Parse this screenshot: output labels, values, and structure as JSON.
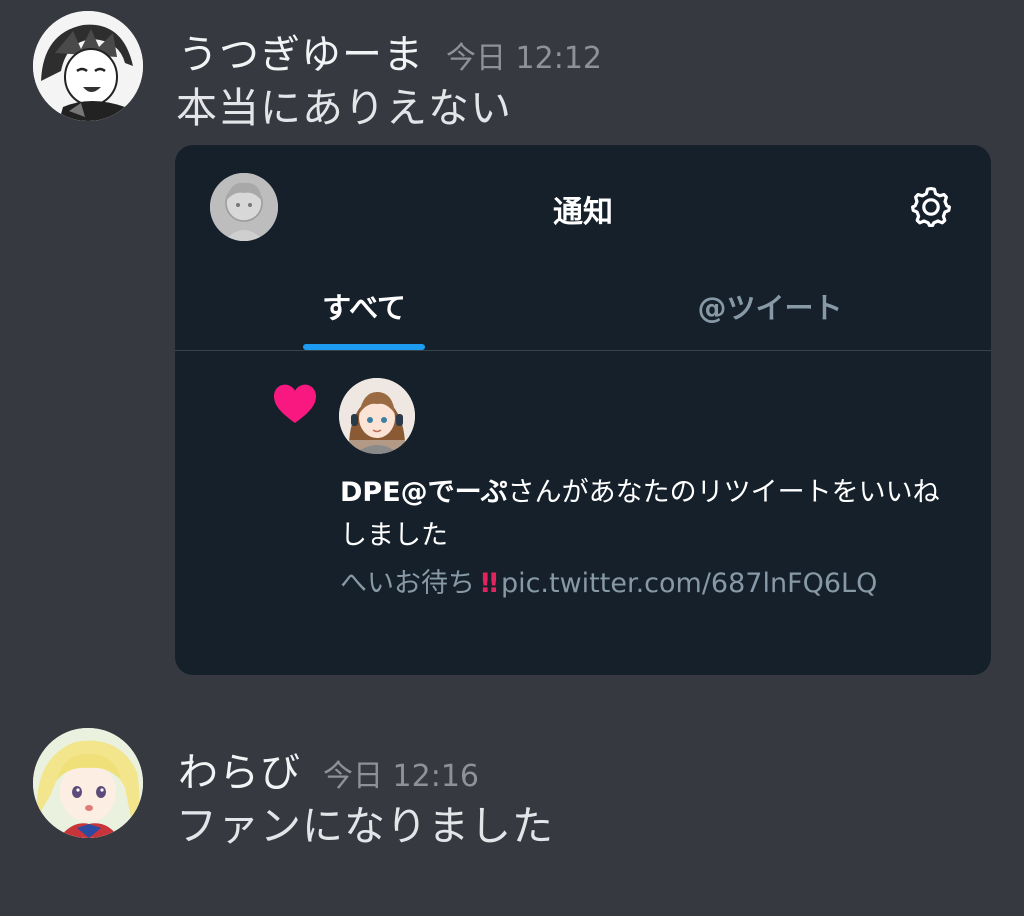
{
  "messages": [
    {
      "username": "うつぎゆーま",
      "timestamp": "今日 12:12",
      "content": "本当にありえない"
    },
    {
      "username": "わらび",
      "timestamp": "今日 12:16",
      "content": "ファンになりました"
    }
  ],
  "embed": {
    "title": "通知",
    "tabs": [
      {
        "label": "すべて",
        "active": true
      },
      {
        "label": "@ツイート",
        "active": false
      }
    ],
    "notification": {
      "user": "DPE@でーぷ",
      "action": "さんがあなたのリツイートをいいねしました",
      "tweet_text": "へいお待ち",
      "tweet_emoji": "‼",
      "tweet_link": "pic.twitter.com/687lnFQ6LQ"
    },
    "colors": {
      "background": "#15202b",
      "accent": "#1d9bf0",
      "like": "#f91880",
      "muted": "#8899a6"
    },
    "icons": [
      "avatar",
      "gear-icon",
      "heart-icon"
    ]
  },
  "colors": {
    "chat_background": "#36393f",
    "username": "#f2f3f5",
    "timestamp": "#8e9297"
  }
}
